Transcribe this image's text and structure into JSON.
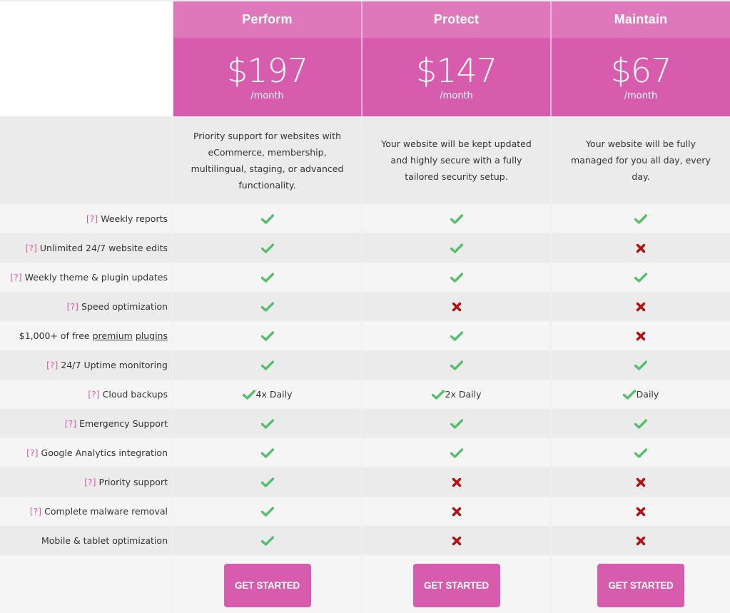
{
  "colors": {
    "header_pink": "#df78bb",
    "price_pink": "#d75cae",
    "check_green": "#55c06a",
    "cross_red": "#b50e0e",
    "help_pink": "#d75cae"
  },
  "plans": [
    {
      "name": "Perform",
      "price": "$197",
      "period": "/month",
      "description": "Priority support for websites with eCommerce, membership, multilingual, staging, or advanced functionality.",
      "cta": "GET STARTED"
    },
    {
      "name": "Protect",
      "price": "$147",
      "period": "/month",
      "description": "Your website will be kept updated and highly secure with a fully tailored security setup.",
      "cta": "GET STARTED"
    },
    {
      "name": "Maintain",
      "price": "$67",
      "period": "/month",
      "description": "Your website will be fully managed for you all day, every day.",
      "cta": "GET STARTED"
    }
  ],
  "help_marker": "[?]",
  "features": [
    {
      "label": "Weekly reports",
      "help": true,
      "values": [
        {
          "icon": "check"
        },
        {
          "icon": "check"
        },
        {
          "icon": "check"
        }
      ]
    },
    {
      "label": "Unlimited 24/7 website edits",
      "help": true,
      "values": [
        {
          "icon": "check"
        },
        {
          "icon": "check"
        },
        {
          "icon": "cross"
        }
      ]
    },
    {
      "label": "Weekly theme & plugin updates",
      "help": true,
      "values": [
        {
          "icon": "check"
        },
        {
          "icon": "check"
        },
        {
          "icon": "check"
        }
      ]
    },
    {
      "label": "Speed optimization",
      "help": true,
      "values": [
        {
          "icon": "check"
        },
        {
          "icon": "cross"
        },
        {
          "icon": "cross"
        }
      ]
    },
    {
      "label_prefix": "$1,000+ of free ",
      "label_link1": "premium",
      "label_link2": "plugins",
      "help": false,
      "values": [
        {
          "icon": "check"
        },
        {
          "icon": "check"
        },
        {
          "icon": "cross"
        }
      ]
    },
    {
      "label": "24/7 Uptime monitoring",
      "help": true,
      "values": [
        {
          "icon": "check"
        },
        {
          "icon": "check"
        },
        {
          "icon": "check"
        }
      ]
    },
    {
      "label": "Cloud backups",
      "help": true,
      "values": [
        {
          "icon": "check",
          "text": "4x Daily"
        },
        {
          "icon": "check",
          "text": "2x Daily"
        },
        {
          "icon": "check",
          "text": "Daily"
        }
      ]
    },
    {
      "label": "Emergency Support",
      "help": true,
      "values": [
        {
          "icon": "check"
        },
        {
          "icon": "check"
        },
        {
          "icon": "check"
        }
      ]
    },
    {
      "label": "Google Analytics integration",
      "help": true,
      "values": [
        {
          "icon": "check"
        },
        {
          "icon": "check"
        },
        {
          "icon": "check"
        }
      ]
    },
    {
      "label": "Priority support",
      "help": true,
      "values": [
        {
          "icon": "check"
        },
        {
          "icon": "cross"
        },
        {
          "icon": "cross"
        }
      ]
    },
    {
      "label": "Complete malware removal",
      "help": true,
      "values": [
        {
          "icon": "check"
        },
        {
          "icon": "cross"
        },
        {
          "icon": "cross"
        }
      ]
    },
    {
      "label": "Mobile & tablet optimization",
      "help": false,
      "values": [
        {
          "icon": "check"
        },
        {
          "icon": "cross"
        },
        {
          "icon": "cross"
        }
      ]
    }
  ]
}
